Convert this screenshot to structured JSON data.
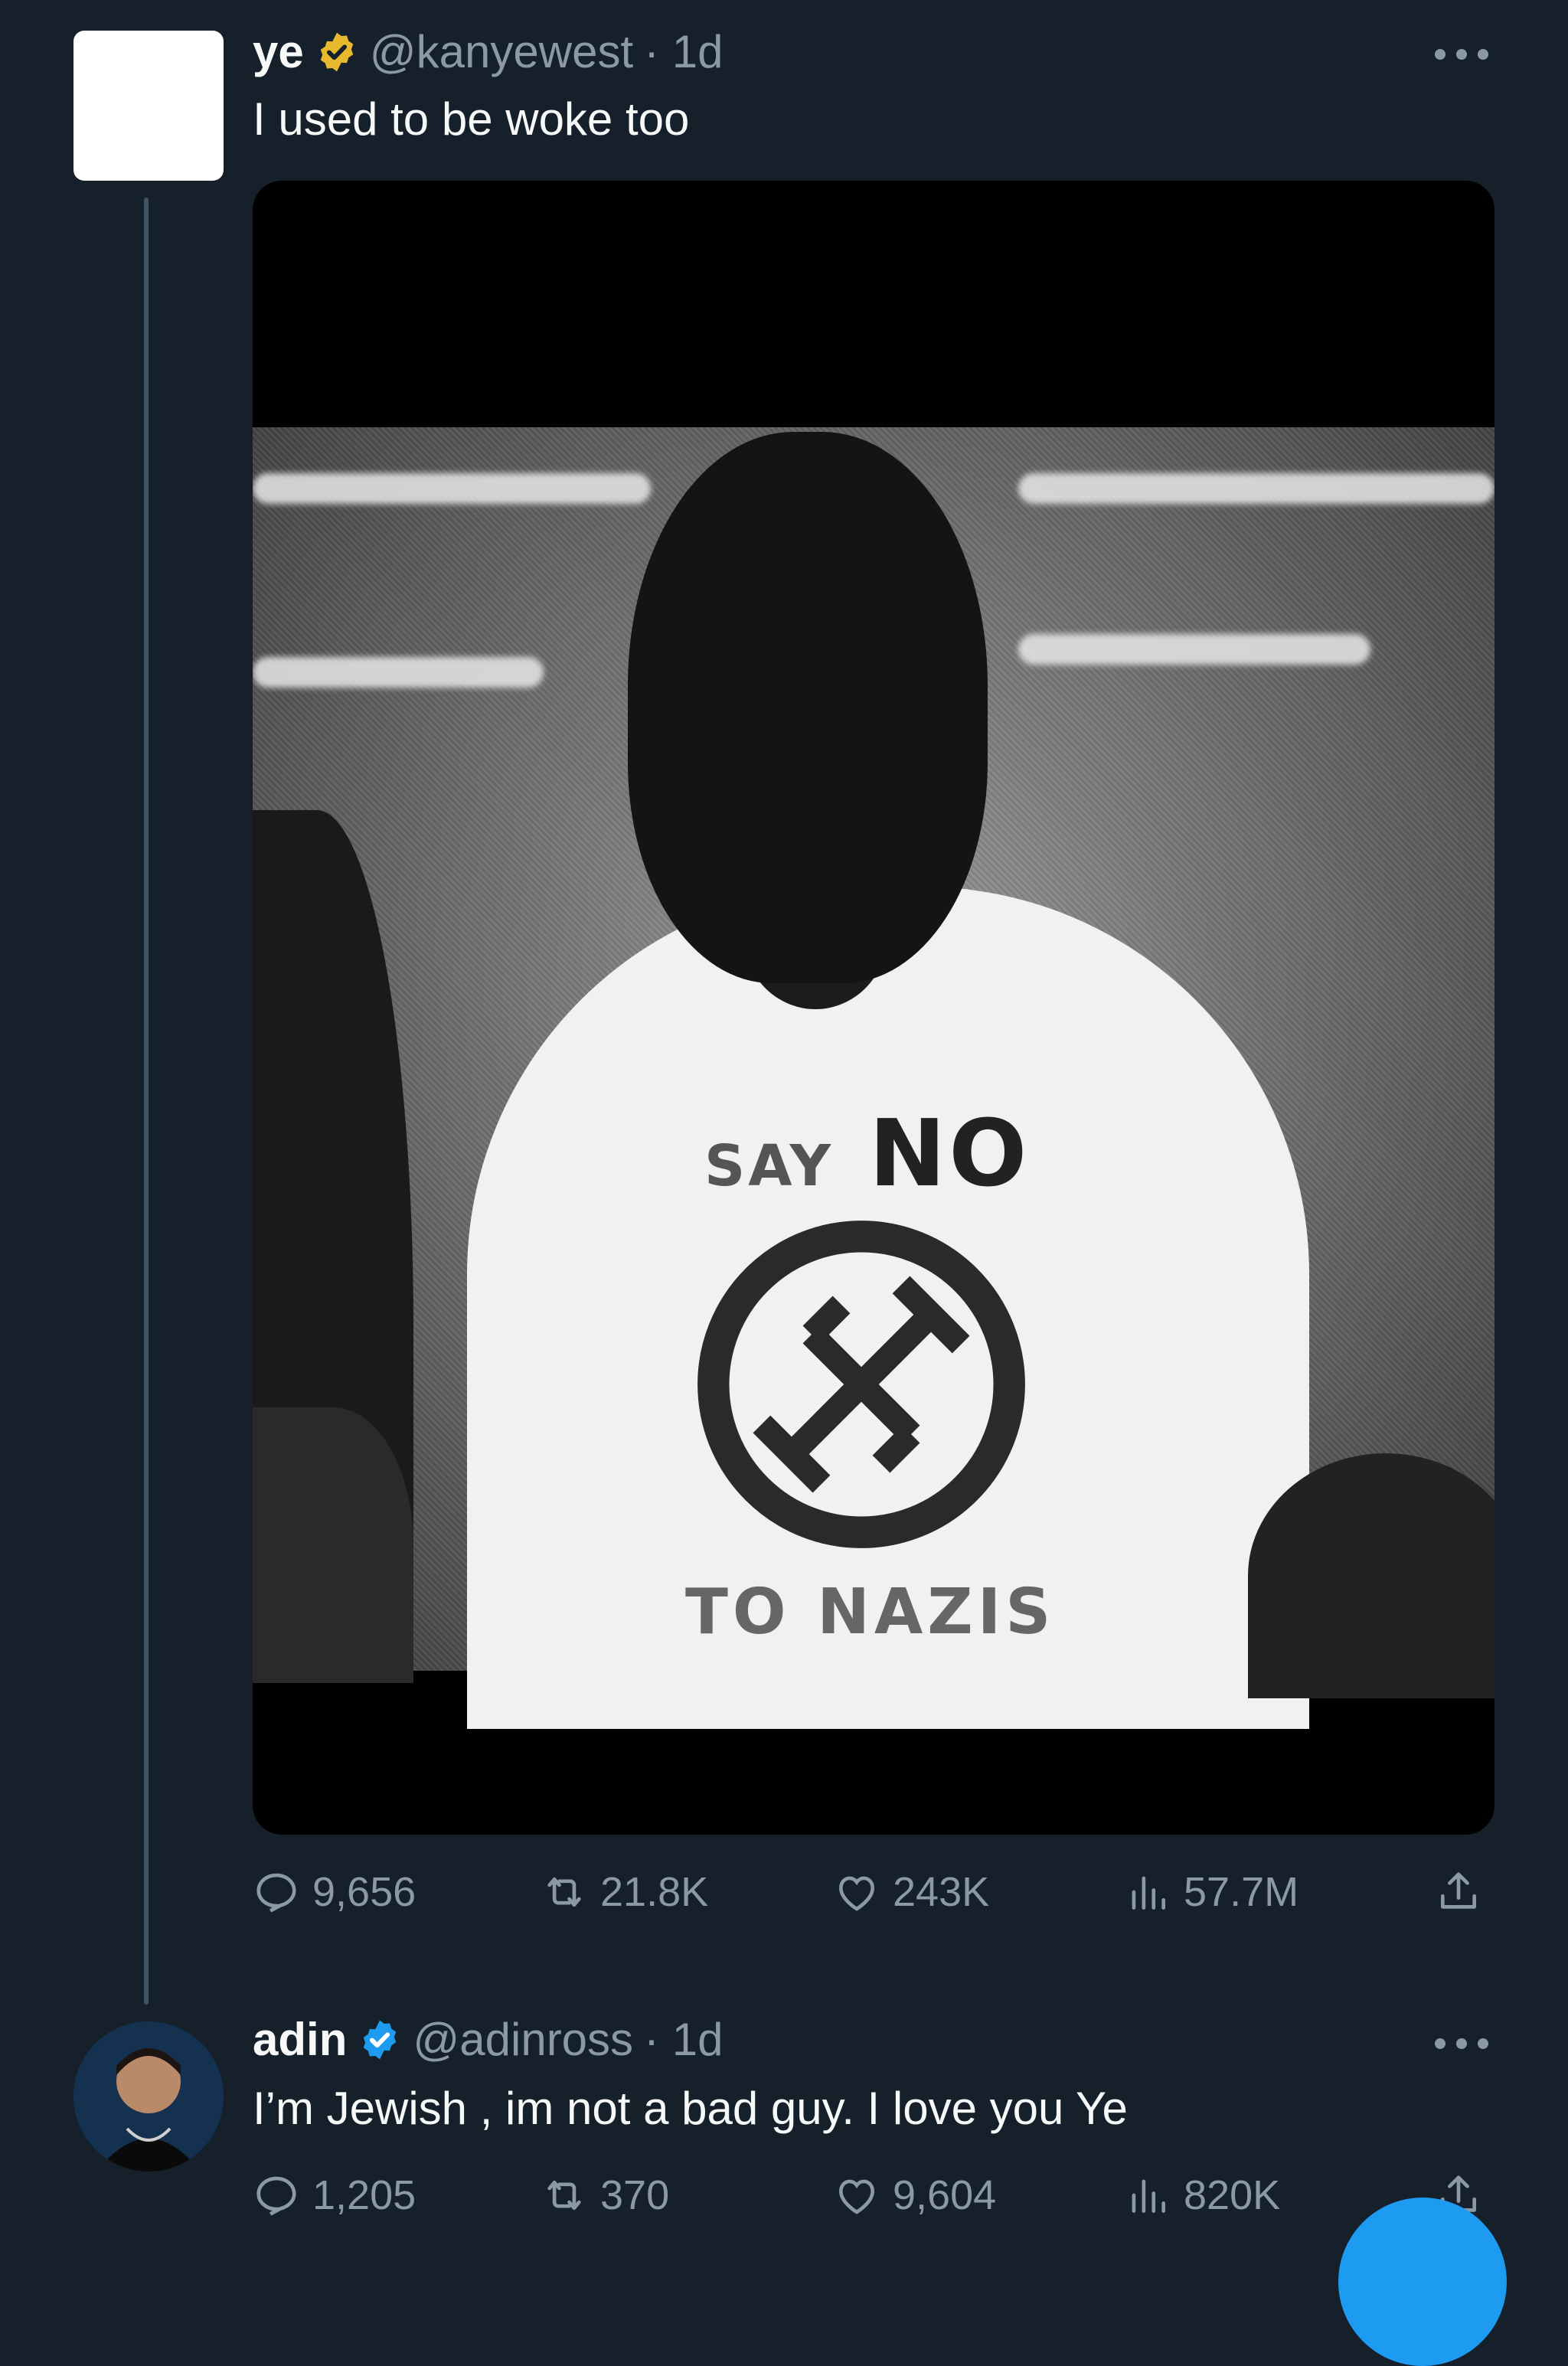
{
  "tweets": [
    {
      "name": "ye",
      "verified": "gold",
      "handle": "@kanyewest",
      "time": "· 1d",
      "text": "I used to be woke too",
      "media": {
        "shirt_line1_small": "SAY",
        "shirt_line1_big": "NO",
        "shirt_line2": "TO NAZIS"
      },
      "stats": {
        "replies": "9,656",
        "retweets": "21.8K",
        "likes": "243K",
        "views": "57.7M"
      }
    },
    {
      "name": "adin",
      "verified": "blue",
      "handle": "@adinross",
      "time": "· 1d",
      "text": "I’m Jewish , im not a bad guy. I love you Ye",
      "stats": {
        "replies": "1,205",
        "retweets": "370",
        "likes": "9,604",
        "views": "820K"
      }
    }
  ],
  "colors": {
    "background": "#15202b",
    "muted": "#8b98a5",
    "gold_badge": "#e8b82e",
    "blue_badge": "#1d9bf0",
    "fab": "#1d9bf0"
  },
  "icons": [
    "more-icon",
    "verified-gold-icon",
    "verified-blue-icon",
    "reply-icon",
    "retweet-icon",
    "like-icon",
    "views-icon",
    "share-icon",
    "compose-icon"
  ]
}
